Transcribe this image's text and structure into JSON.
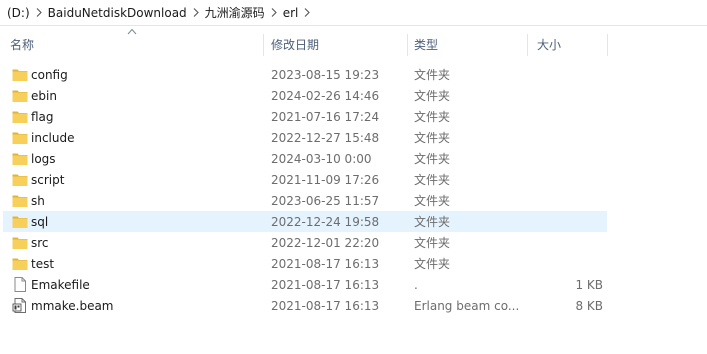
{
  "breadcrumb": {
    "items": [
      "(D:)",
      "BaiduNetdiskDownload",
      "九洲渝源码",
      "erl"
    ]
  },
  "columns": {
    "name": "名称",
    "date": "修改日期",
    "type": "类型",
    "size": "大小"
  },
  "files": [
    {
      "name": "config",
      "date": "2023-08-15 19:23",
      "type": "文件夹",
      "size": "",
      "icon": "folder-icon"
    },
    {
      "name": "ebin",
      "date": "2024-02-26 14:46",
      "type": "文件夹",
      "size": "",
      "icon": "folder-icon"
    },
    {
      "name": "flag",
      "date": "2021-07-16 17:24",
      "type": "文件夹",
      "size": "",
      "icon": "folder-icon"
    },
    {
      "name": "include",
      "date": "2022-12-27 15:48",
      "type": "文件夹",
      "size": "",
      "icon": "folder-icon"
    },
    {
      "name": "logs",
      "date": "2024-03-10 0:00",
      "type": "文件夹",
      "size": "",
      "icon": "folder-icon"
    },
    {
      "name": "script",
      "date": "2021-11-09 17:26",
      "type": "文件夹",
      "size": "",
      "icon": "folder-icon"
    },
    {
      "name": "sh",
      "date": "2023-06-25 11:57",
      "type": "文件夹",
      "size": "",
      "icon": "folder-icon"
    },
    {
      "name": "sql",
      "date": "2022-12-24 19:58",
      "type": "文件夹",
      "size": "",
      "icon": "folder-icon"
    },
    {
      "name": "src",
      "date": "2022-12-01 22:20",
      "type": "文件夹",
      "size": "",
      "icon": "folder-icon"
    },
    {
      "name": "test",
      "date": "2021-08-17 16:13",
      "type": "文件夹",
      "size": "",
      "icon": "folder-icon"
    },
    {
      "name": "Emakefile",
      "date": "2021-08-17 16:13",
      "type": ".",
      "size": "1 KB",
      "icon": "file-icon"
    },
    {
      "name": "mmake.beam",
      "date": "2021-08-17 16:13",
      "type": "Erlang beam co...",
      "size": "8 KB",
      "icon": "beam-file-icon"
    }
  ],
  "hovered_row": 7,
  "colors": {
    "folder": "#f7cf5b",
    "folder_dark": "#e2b33a",
    "hover": "#e5f3ff",
    "header_text": "#4c607a"
  }
}
